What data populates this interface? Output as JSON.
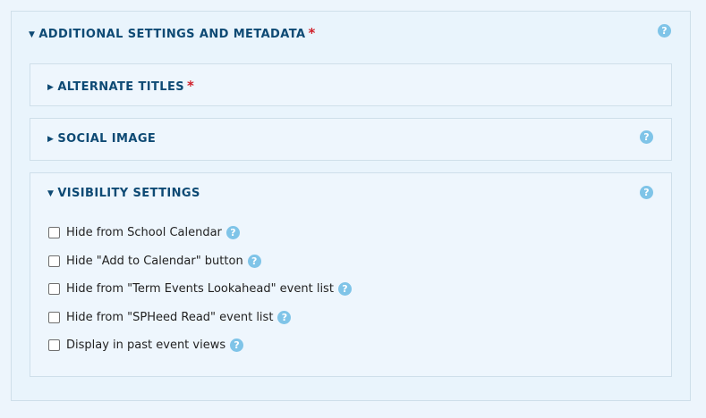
{
  "section": {
    "title": "ADDITIONAL SETTINGS AND METADATA",
    "required_mark": "*"
  },
  "alternate_titles": {
    "title": "ALTERNATE TITLES",
    "required_mark": "*"
  },
  "social_image": {
    "title": "SOCIAL IMAGE"
  },
  "visibility": {
    "title": "VISIBILITY SETTINGS",
    "options": [
      {
        "label": "Hide from School Calendar",
        "checked": false
      },
      {
        "label": "Hide \"Add to Calendar\" button",
        "checked": false
      },
      {
        "label": "Hide from \"Term Events Lookahead\" event list",
        "checked": false
      },
      {
        "label": "Hide from \"SPHeed Read\" event list",
        "checked": false
      },
      {
        "label": "Display in past event views",
        "checked": false
      }
    ]
  },
  "help_glyph": "?",
  "icons": {
    "expanded": "triangle-down-icon",
    "collapsed": "triangle-right-icon",
    "help": "help-icon"
  },
  "colors": {
    "heading": "#0e4a74",
    "required": "#d0202a",
    "help": "#7fc4e8",
    "border": "#cfdfea"
  }
}
